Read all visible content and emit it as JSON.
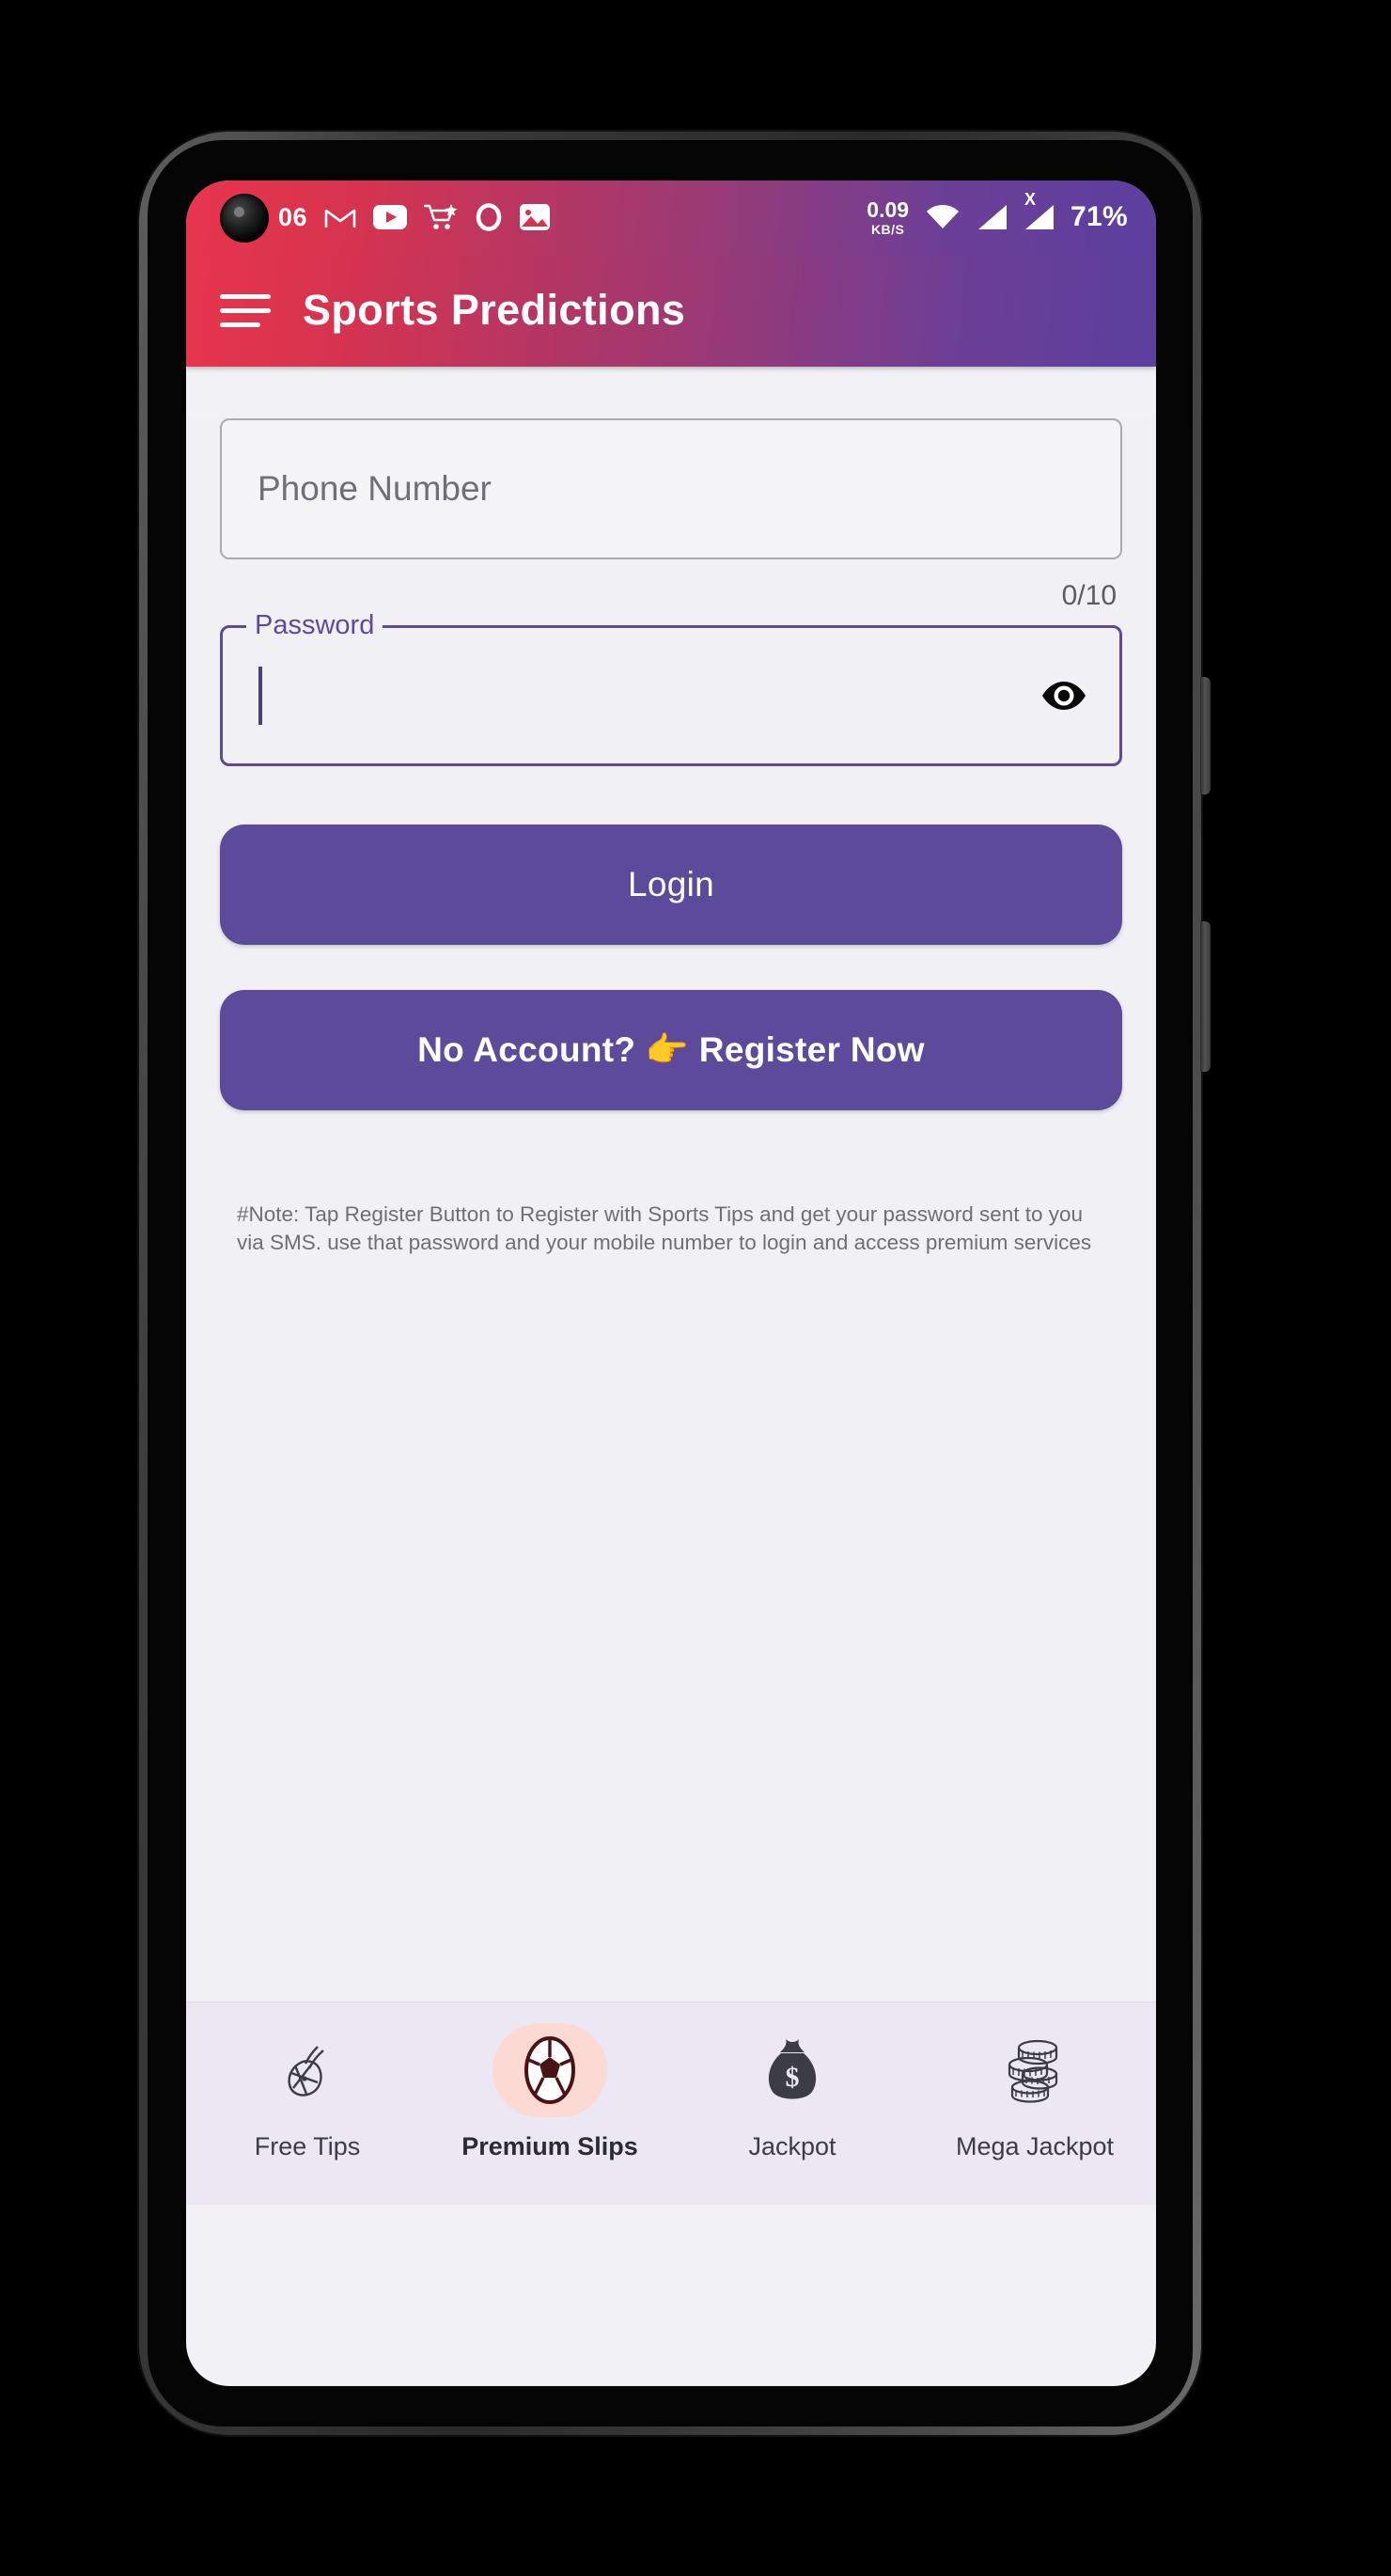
{
  "statusbar": {
    "time": "06",
    "left_icons": [
      "camera-punchhole",
      "gmail-icon",
      "youtube-icon",
      "shopping-cart-icon",
      "opera-icon",
      "gallery-icon"
    ],
    "net_speed_value": "0.09",
    "net_speed_unit": "KB/S",
    "wifi_icon": "wifi-icon",
    "signal_icon": "signal-bars-icon",
    "signal_x_icon": "signal-x-icon",
    "signal_x_label": "X",
    "battery": "71%"
  },
  "appbar": {
    "menu_icon": "hamburger-menu-icon",
    "title": "Sports Predictions",
    "gradient_start": "#e8354e",
    "gradient_end": "#5b3f9e"
  },
  "form": {
    "phone": {
      "placeholder": "Phone Number",
      "value": ""
    },
    "password": {
      "label": "Password",
      "value": "",
      "counter": "0/10",
      "toggle_icon": "eye-icon"
    },
    "login_label": "Login",
    "register_label": "No Account? 👉 Register Now",
    "accent_color": "#5e4a9b"
  },
  "note": {
    "text": "#Note: Tap Register Button to Register with Sports Tips and get your password sent to you via SMS. use that password and your mobile number to login and access premium services"
  },
  "bottomnav": {
    "active_index": 1,
    "active_pill_color": "#fdd9d3",
    "items": [
      {
        "label": "Free Tips",
        "icon": "soccer-cleat-icon"
      },
      {
        "label": "Premium Slips",
        "icon": "soccer-ball-icon"
      },
      {
        "label": "Jackpot",
        "icon": "money-bag-icon"
      },
      {
        "label": "Mega Jackpot",
        "icon": "coin-stack-icon"
      }
    ]
  }
}
